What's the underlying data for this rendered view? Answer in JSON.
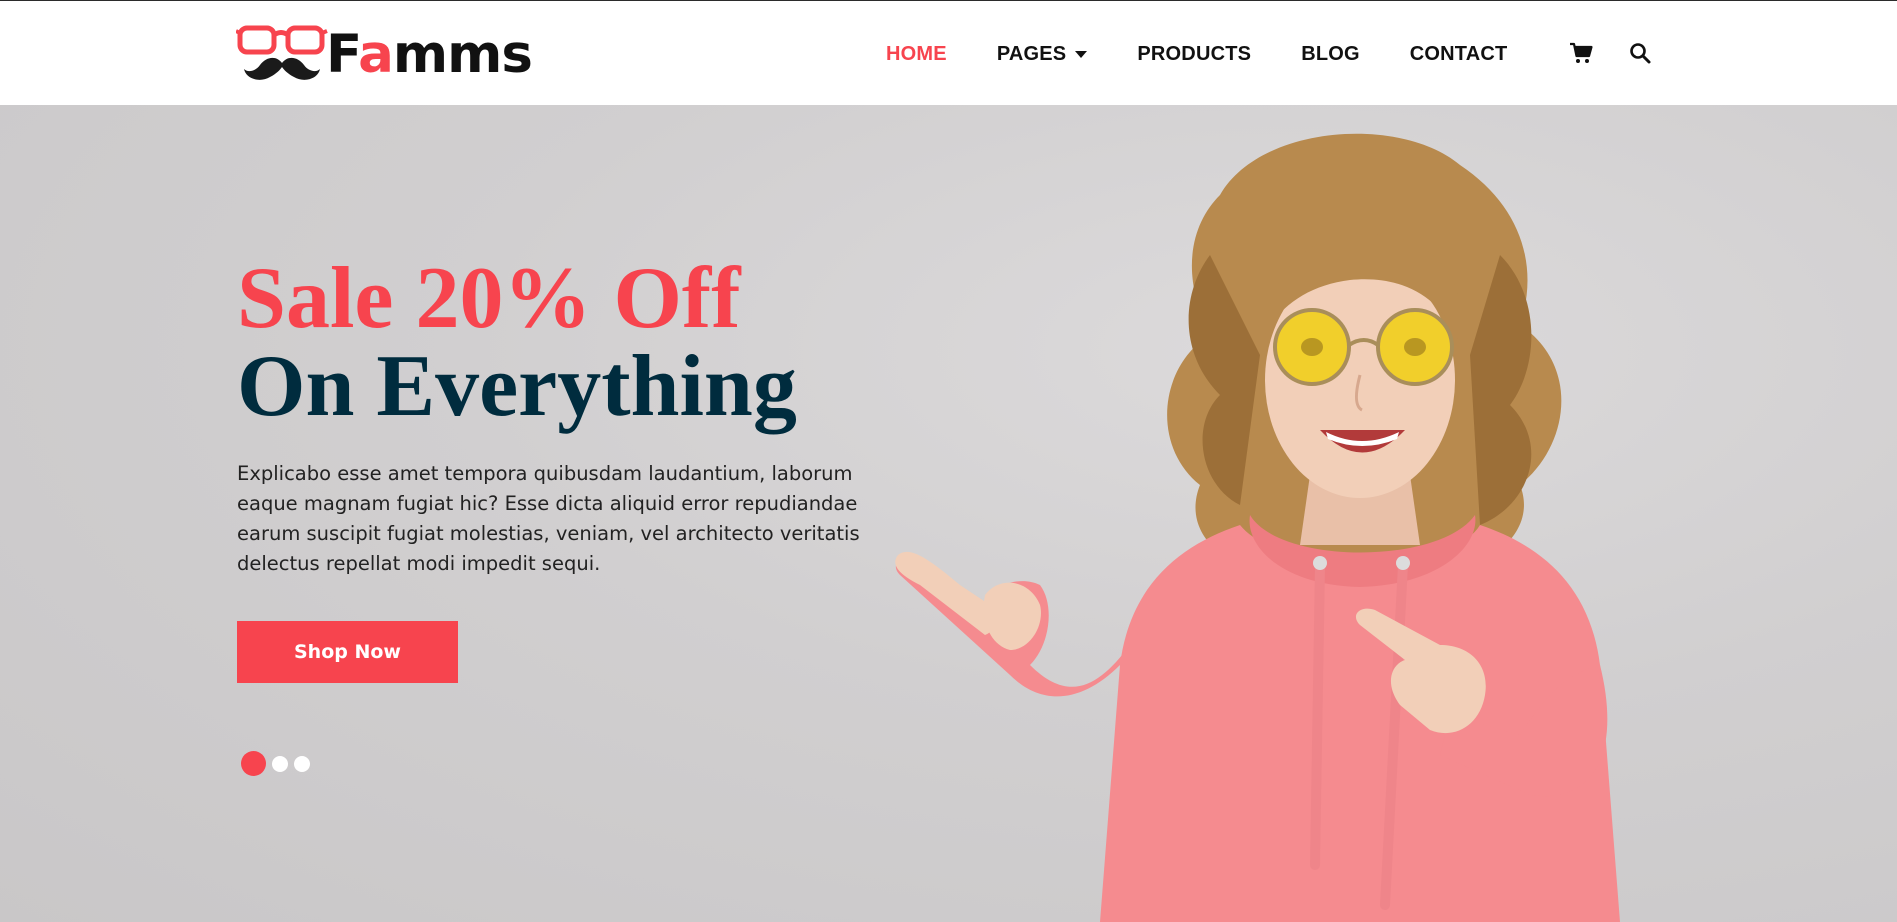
{
  "brand": {
    "name_prefix": "F",
    "name_accent": "a",
    "name_suffix": "mms"
  },
  "nav": {
    "items": [
      {
        "label": "HOME",
        "active": true
      },
      {
        "label": "PAGES",
        "dropdown": true
      },
      {
        "label": "PRODUCTS"
      },
      {
        "label": "BLOG"
      },
      {
        "label": "CONTACT"
      }
    ],
    "icons": [
      "cart-icon",
      "search-icon"
    ]
  },
  "hero": {
    "title_line_1": "Sale 20% Off",
    "title_line_2": "On Everything",
    "description": "Explicabo esse amet tempora quibusdam laudantium, laborum eaque magnam fugiat hic? Esse dicta aliquid error repudiandae earum suscipit fugiat molestias, veniam, vel architecto veritatis delectus repellat modi impedit sequi.",
    "cta_label": "Shop Now",
    "slides": 3,
    "active_slide": 1
  },
  "colors": {
    "accent": "#f7444e",
    "heading_dark": "#002c3e",
    "hero_bg": "#d1cfd0"
  }
}
